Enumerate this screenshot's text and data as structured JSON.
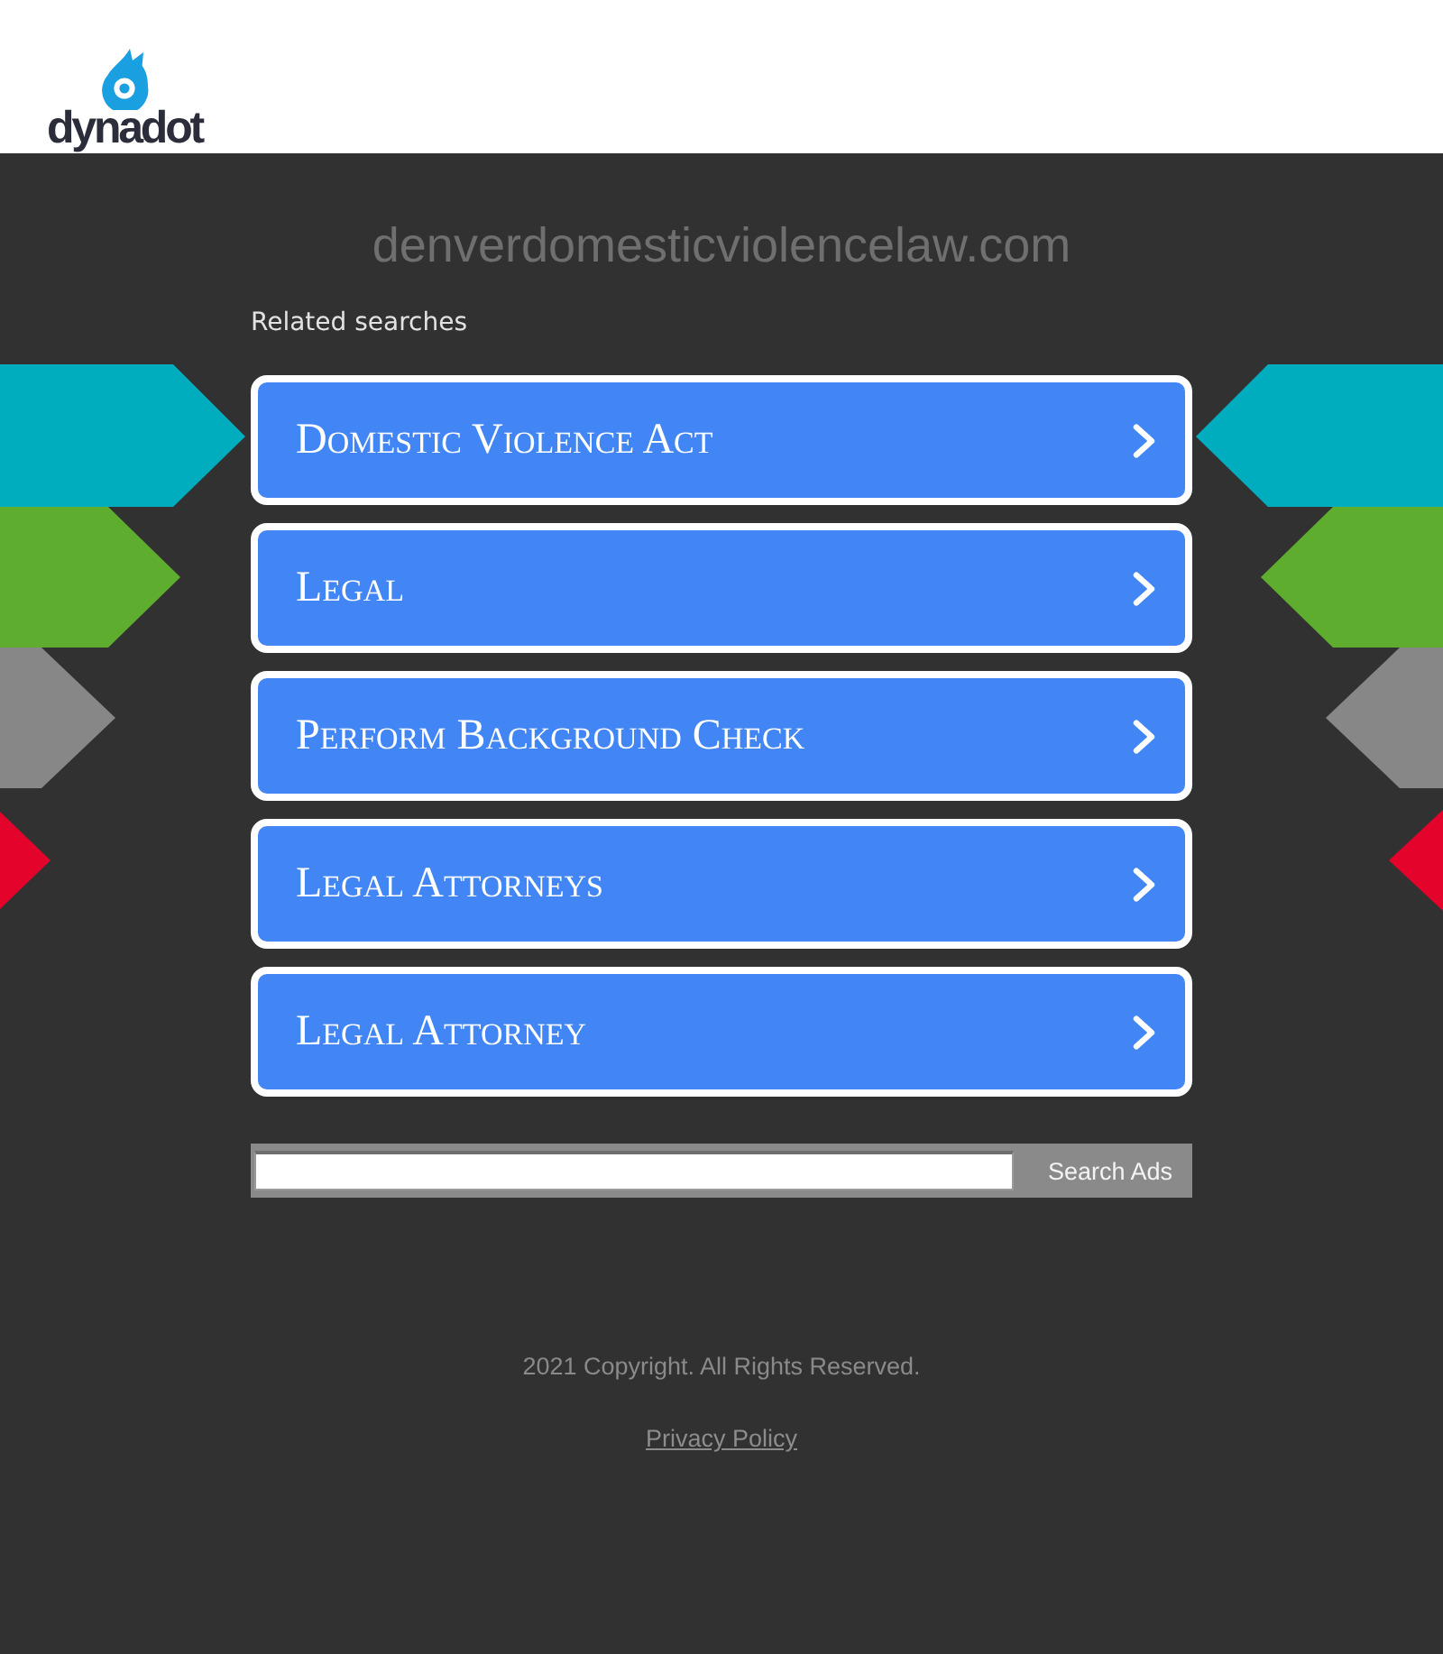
{
  "header": {
    "logo_text": "dynadot"
  },
  "domain_title": "denverdomesticviolencelaw.com",
  "related_searches": {
    "heading": "Related searches",
    "links": [
      "Domestic Violence Act",
      "Legal",
      "Perform Background Check",
      "Legal Attorneys",
      "Legal Attorney"
    ]
  },
  "search": {
    "button": "Search Ads"
  },
  "footer": {
    "copyright": "2021 Copyright. All Rights Reserved.",
    "privacy_link": "Privacy Policy"
  }
}
